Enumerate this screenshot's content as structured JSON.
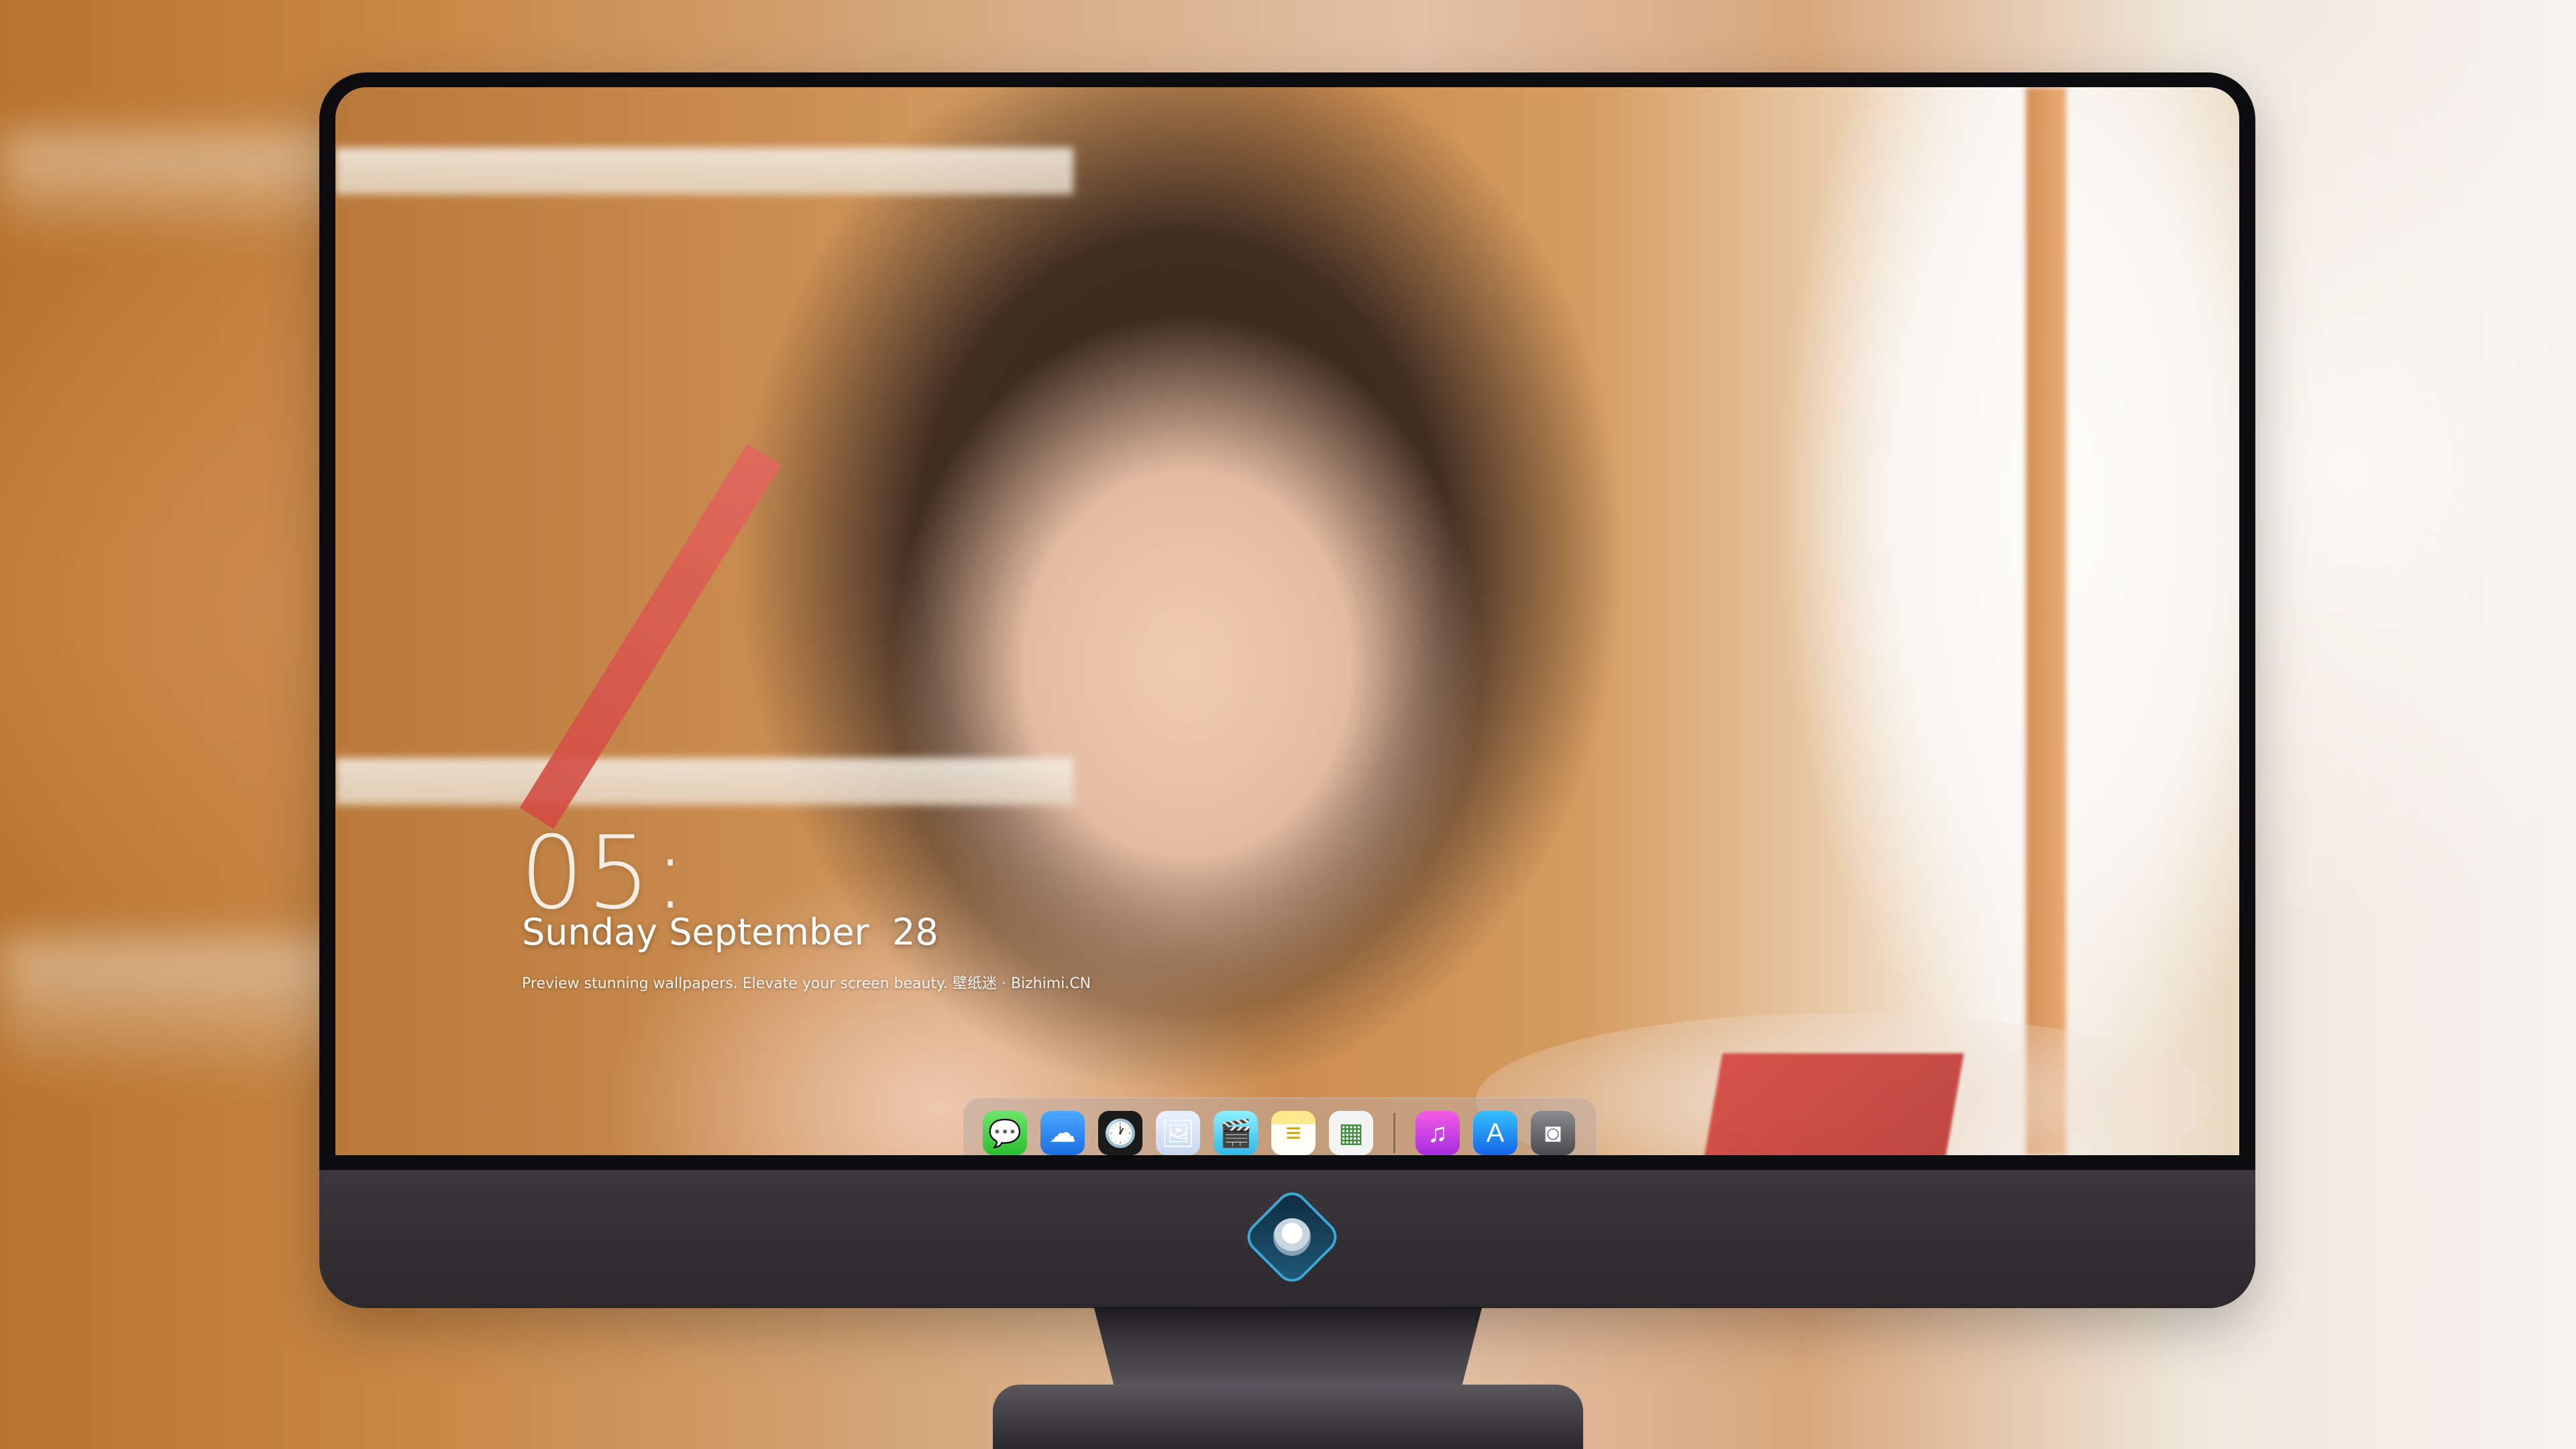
{
  "lockscreen": {
    "time": "05:",
    "date": "Sunday September  28",
    "tagline": "Preview stunning wallpapers. Elevate your screen beauty. 壁纸迷 · Bizhimi.CN"
  },
  "dock": {
    "apps": [
      {
        "name": "messages-icon",
        "glyph": "💬"
      },
      {
        "name": "weather-icon",
        "glyph": "☁"
      },
      {
        "name": "clock-icon",
        "glyph": "🕐"
      },
      {
        "name": "preview-icon",
        "glyph": "🖼"
      },
      {
        "name": "video-icon",
        "glyph": "🎬"
      },
      {
        "name": "notes-icon",
        "glyph": "≡"
      },
      {
        "name": "photos-icon",
        "glyph": "▦"
      }
    ],
    "apps_right": [
      {
        "name": "music-icon",
        "glyph": "♫"
      },
      {
        "name": "app-store-icon",
        "glyph": "A"
      },
      {
        "name": "camera-icon",
        "glyph": "◙"
      }
    ]
  },
  "colors": {
    "monitor_bezel": "#0d0d0f",
    "chin": "#3c373c",
    "logo_accent": "#3aa8d8"
  }
}
